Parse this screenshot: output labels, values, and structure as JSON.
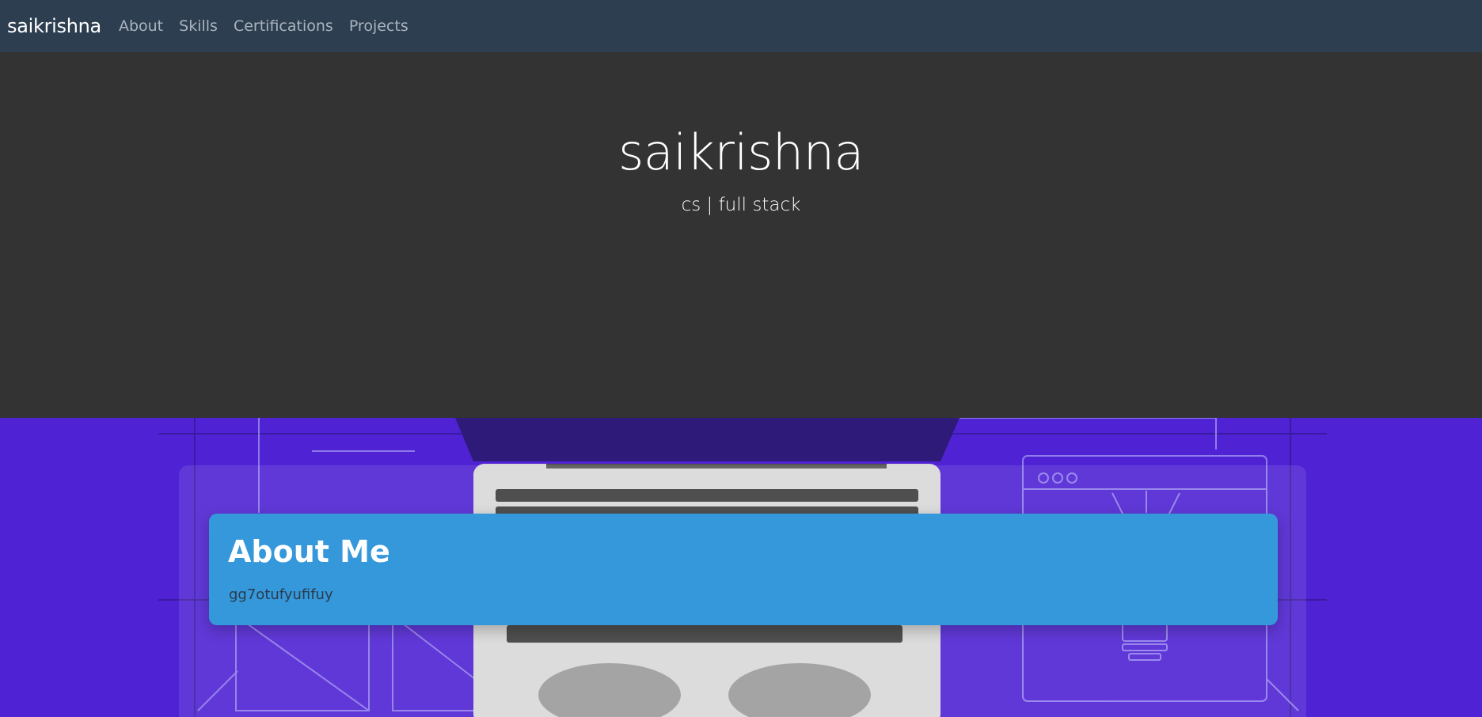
{
  "nav": {
    "brand": "saikrishna",
    "links": [
      {
        "label": "About"
      },
      {
        "label": "Skills"
      },
      {
        "label": "Certifications"
      },
      {
        "label": "Projects"
      }
    ]
  },
  "hero": {
    "title": "saikrishna",
    "subtitle": "cs | full stack"
  },
  "about": {
    "title": "About Me",
    "text": "gg7otufyufifuy"
  },
  "colors": {
    "navbar": "#2c3e50",
    "hero": "#333333",
    "section_bg": "#4f22d3",
    "card": "#3598db"
  }
}
